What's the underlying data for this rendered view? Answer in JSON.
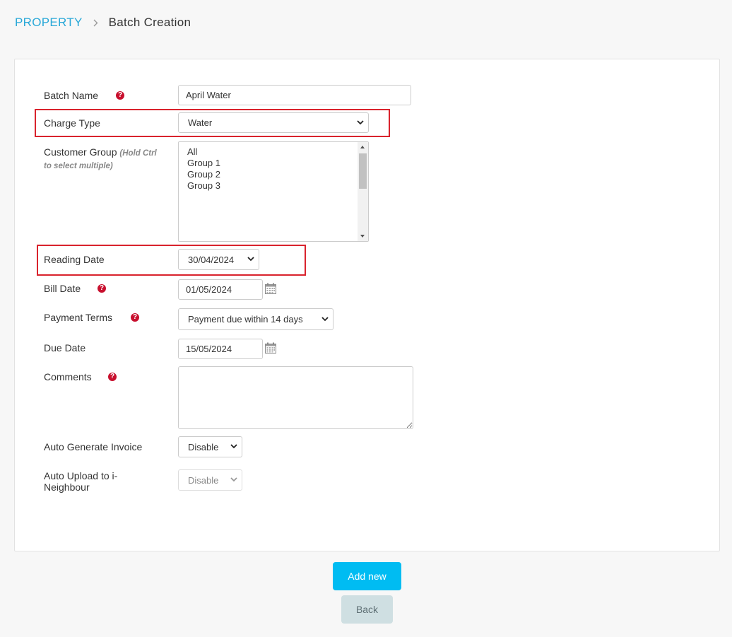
{
  "breadcrumb": {
    "root": "PROPERTY",
    "current": "Batch Creation"
  },
  "form": {
    "batch_name": {
      "label": "Batch Name",
      "value": "April Water"
    },
    "charge_type": {
      "label": "Charge Type",
      "selected": "Water"
    },
    "customer_group": {
      "label": "Customer Group",
      "hint": "(Hold Ctrl to select multiple)",
      "options": [
        "All",
        "Group 1",
        "Group 2",
        "Group 3"
      ]
    },
    "reading_date": {
      "label": "Reading Date",
      "selected": "30/04/2024"
    },
    "bill_date": {
      "label": "Bill Date",
      "value": "01/05/2024"
    },
    "payment_terms": {
      "label": "Payment Terms",
      "selected": "Payment due within 14 days"
    },
    "due_date": {
      "label": "Due Date",
      "value": "15/05/2024"
    },
    "comments": {
      "label": "Comments",
      "value": ""
    },
    "auto_generate_invoice": {
      "label": "Auto Generate Invoice",
      "selected": "Disable"
    },
    "auto_upload": {
      "label": "Auto Upload to i-Neighbour",
      "selected": "Disable"
    }
  },
  "buttons": {
    "add_new": "Add new",
    "back": "Back"
  },
  "icons": {
    "help": "?"
  },
  "colors": {
    "accent": "#29a8d8",
    "primary_button": "#00bcf2",
    "help_icon": "#c8102e",
    "highlight": "#d9232d"
  }
}
